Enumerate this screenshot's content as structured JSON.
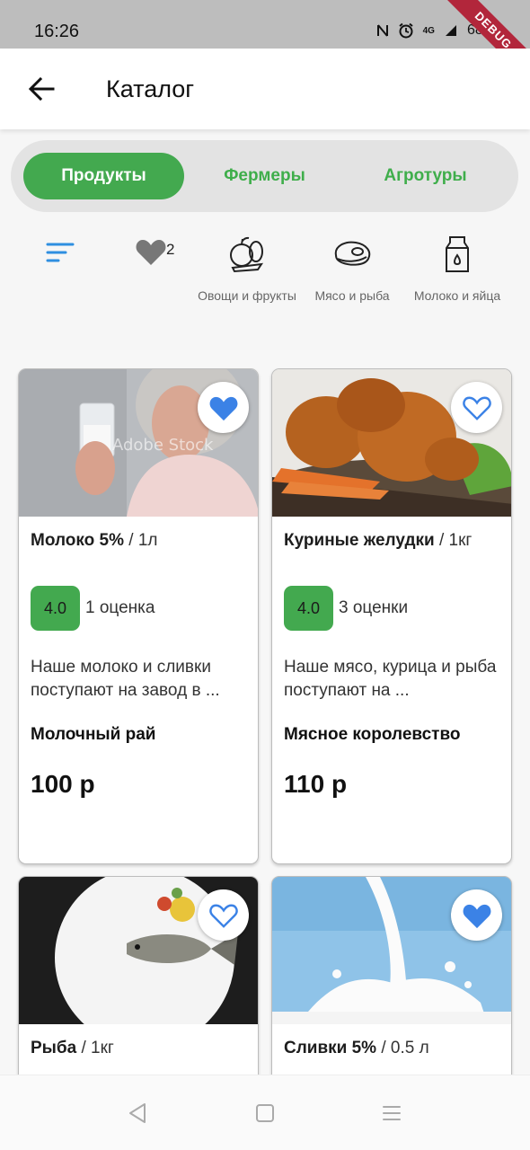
{
  "status_bar": {
    "time": "16:26",
    "battery": "68%",
    "network": "4G",
    "debug_label": "DEBUG"
  },
  "app_bar": {
    "title": "Каталог",
    "back_icon": "arrow-left-icon"
  },
  "segments": [
    {
      "label": "Продукты",
      "active": true
    },
    {
      "label": "Фермеры",
      "active": false
    },
    {
      "label": "Агротуры",
      "active": false
    }
  ],
  "filters": {
    "sort_icon": "sort-icon",
    "favorites_count": "2",
    "categories": [
      {
        "label": "Овощи и фрукты",
        "icon": "vegetables-icon"
      },
      {
        "label": "Мясо и рыба",
        "icon": "meat-icon"
      },
      {
        "label": "Молоко и яйца",
        "icon": "milk-icon"
      }
    ]
  },
  "products": [
    {
      "name": "Молоко 5%",
      "unit": "/ 1л",
      "rating": "4.0",
      "rating_count": "1 оценка",
      "description": "Наше молоко и сливки поступают на завод в ...",
      "seller": "Молочный рай",
      "price": "100 р",
      "favorite": true,
      "watermark": "Adobe Stock"
    },
    {
      "name": "Куриные желудки",
      "unit": "/ 1кг",
      "rating": "4.0",
      "rating_count": "3 оценки",
      "description": "Наше мясо, курица и рыба поступают на ...",
      "seller": "Мясное королевство",
      "price": "110 р",
      "favorite": false
    },
    {
      "name": "Рыба",
      "unit": "/ 1кг",
      "favorite": false
    },
    {
      "name": "Сливки 5%",
      "unit": "/ 0.5 л",
      "favorite": true
    }
  ],
  "colors": {
    "accent_green": "#43a94f",
    "favorite_blue": "#3b82e6",
    "sort_blue": "#2f8fe0"
  }
}
